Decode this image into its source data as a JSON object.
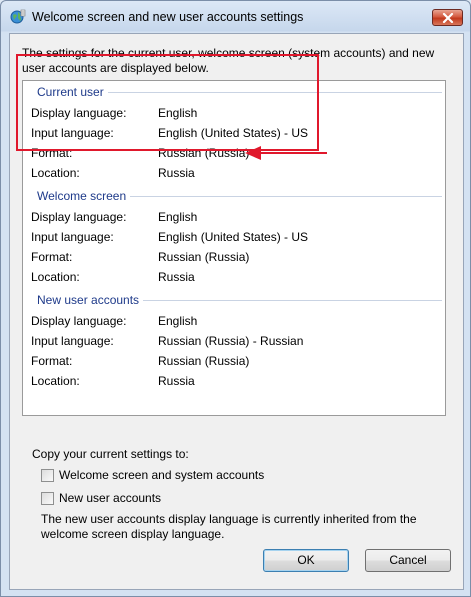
{
  "window": {
    "title": "Welcome screen and new user accounts settings"
  },
  "intro_text": "The settings for the current user, welcome screen (system accounts) and new user accounts are displayed below.",
  "groups": [
    {
      "title": "Current user",
      "rows": [
        {
          "label": "Display language:",
          "value": "English"
        },
        {
          "label": "Input language:",
          "value": "English (United States) - US"
        },
        {
          "label": "Format:",
          "value": "Russian (Russia)"
        },
        {
          "label": "Location:",
          "value": "Russia"
        }
      ]
    },
    {
      "title": "Welcome screen",
      "rows": [
        {
          "label": "Display language:",
          "value": "English"
        },
        {
          "label": "Input language:",
          "value": "English (United States) - US"
        },
        {
          "label": "Format:",
          "value": "Russian (Russia)"
        },
        {
          "label": "Location:",
          "value": "Russia"
        }
      ]
    },
    {
      "title": "New user accounts",
      "rows": [
        {
          "label": "Display language:",
          "value": "English"
        },
        {
          "label": "Input language:",
          "value": "Russian (Russia) - Russian"
        },
        {
          "label": "Format:",
          "value": "Russian (Russia)"
        },
        {
          "label": "Location:",
          "value": "Russia"
        }
      ]
    }
  ],
  "copy_label": "Copy your current settings to:",
  "checkboxes": [
    {
      "label": "Welcome screen and system accounts",
      "checked": false
    },
    {
      "label": "New user accounts",
      "checked": false
    }
  ],
  "note": "The new user accounts display language is currently inherited from the welcome screen display language.",
  "buttons": {
    "ok": "OK",
    "cancel": "Cancel"
  },
  "annotation": {
    "highlight_color": "#e0182c"
  }
}
